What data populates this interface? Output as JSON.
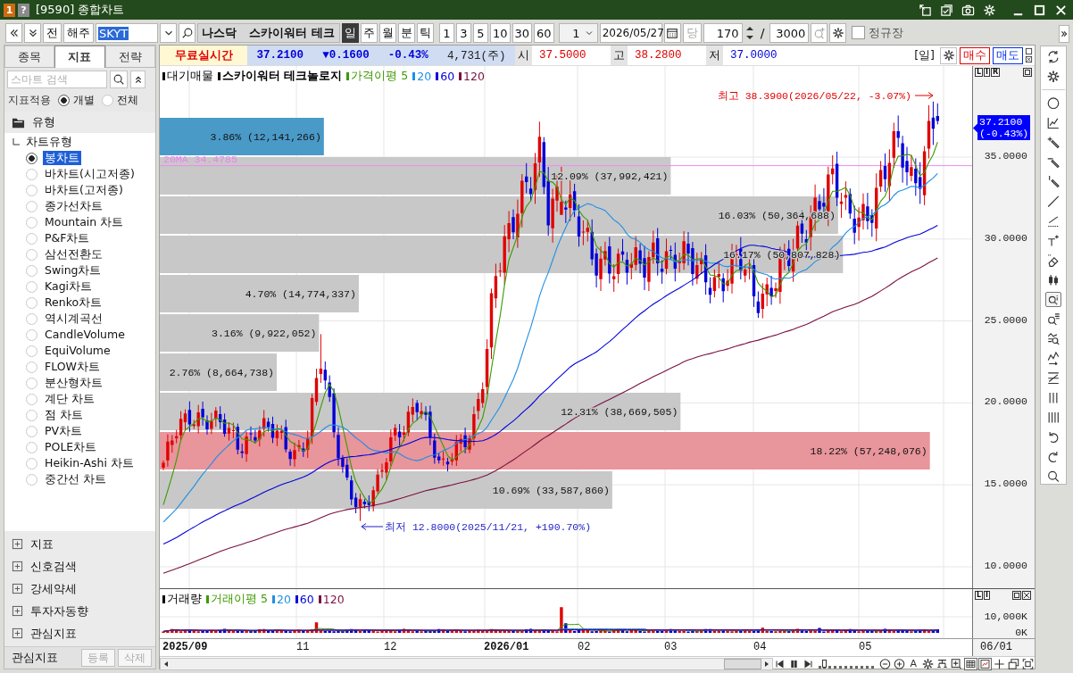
{
  "window": {
    "badge": "1",
    "help": "?",
    "title": "[9590] 종합차트"
  },
  "toolbar": {
    "buttons": [
      "전",
      "해주"
    ],
    "symbol": "SKYT",
    "market": "나스닥",
    "name": "스카이워터 테크",
    "periods": [
      {
        "label": "일",
        "selected": true
      },
      {
        "label": "주",
        "selected": false
      },
      {
        "label": "월",
        "selected": false
      },
      {
        "label": "분",
        "selected": false
      },
      {
        "label": "틱",
        "selected": false
      }
    ],
    "intervals": [
      {
        "label": "1",
        "selected": false
      },
      {
        "label": "3",
        "selected": false
      },
      {
        "label": "5",
        "selected": false
      },
      {
        "label": "10",
        "selected": false
      },
      {
        "label": "30",
        "selected": false
      },
      {
        "label": "60",
        "selected": false
      }
    ],
    "interval_value": "1",
    "date": "2026/05/27",
    "today_button": {
      "label": "당",
      "disabled": true
    },
    "count": "170",
    "separator": "/",
    "total": "3000",
    "zoom_button": {
      "disabled": true
    },
    "regular_session": {
      "label": "정규장",
      "checked": false
    }
  },
  "left_panel": {
    "tabs": [
      {
        "label": "종목",
        "selected": false
      },
      {
        "label": "지표",
        "selected": true
      },
      {
        "label": "전략",
        "selected": false
      }
    ],
    "search": {
      "placeholder": "스마트 검색"
    },
    "apply": {
      "label": "지표적용",
      "options": [
        {
          "label": "개별",
          "selected": true
        },
        {
          "label": "전체",
          "selected": false
        }
      ]
    },
    "tree": {
      "label": "유형",
      "children": [
        {
          "label": "차트유형",
          "children": [
            {
              "label": "봉차트",
              "selected": true
            },
            {
              "label": "바차트(시고저종)",
              "selected": false
            },
            {
              "label": "바차트(고저종)",
              "selected": false
            },
            {
              "label": "종가선차트",
              "selected": false
            },
            {
              "label": "Mountain 차트",
              "selected": false
            },
            {
              "label": "P&F차트",
              "selected": false
            },
            {
              "label": "삼선전환도",
              "selected": false
            },
            {
              "label": "Swing차트",
              "selected": false
            },
            {
              "label": "Kagi차트",
              "selected": false
            },
            {
              "label": "Renko차트",
              "selected": false
            },
            {
              "label": "역시계곡선",
              "selected": false
            },
            {
              "label": "CandleVolume",
              "selected": false
            },
            {
              "label": "EquiVolume",
              "selected": false
            },
            {
              "label": "FLOW차트",
              "selected": false
            },
            {
              "label": "분산형차트",
              "selected": false
            },
            {
              "label": "계단 차트",
              "selected": false
            },
            {
              "label": "점 차트",
              "selected": false
            },
            {
              "label": "PV차트",
              "selected": false
            },
            {
              "label": "POLE차트",
              "selected": false
            },
            {
              "label": "Heikin-Ashi 차트",
              "selected": false
            },
            {
              "label": "중간선 차트",
              "selected": false
            }
          ]
        }
      ]
    },
    "sections": [
      {
        "label": "지표",
        "expanded": false
      },
      {
        "label": "신호검색",
        "expanded": false
      },
      {
        "label": "강세약세",
        "expanded": false
      },
      {
        "label": "투자자동향",
        "expanded": false
      },
      {
        "label": "관심지표",
        "expanded": false
      }
    ],
    "footer": {
      "label": "관심지표",
      "buttons": [
        {
          "label": "등록",
          "disabled": true
        },
        {
          "label": "삭제",
          "disabled": true
        }
      ]
    }
  },
  "quote": {
    "feed": "무료실시간",
    "summary": [
      {
        "text": "37.2100",
        "color": "#0000d8"
      },
      {
        "text": "▼0.1600",
        "color": "#0000d8"
      },
      {
        "text": "-0.43%",
        "color": "#0000d8"
      },
      {
        "text": "4,731(주)",
        "color": "#222222"
      }
    ],
    "fields": [
      {
        "label": "시",
        "value": "37.5000",
        "color": "#e00000"
      },
      {
        "label": "고",
        "value": "38.2800",
        "color": "#e00000"
      },
      {
        "label": "저",
        "value": "37.0000",
        "color": "#0000d8"
      }
    ],
    "period": "[일]",
    "buy": "매수",
    "sell": "매도"
  },
  "chart": {
    "legend": [
      {
        "label": "대기매물",
        "kind": "indicator",
        "color": "#000000"
      },
      {
        "label": "스카이워터 테크놀로지",
        "kind": "symbol",
        "color": "#000000"
      },
      {
        "label": "가격이평 5",
        "kind": "average",
        "color": "#3c9a00"
      },
      {
        "label": "20",
        "kind": "average",
        "color": "#1e8fe6"
      },
      {
        "label": "60",
        "kind": "average",
        "color": "#0000dc"
      },
      {
        "label": "120",
        "kind": "average",
        "color": "#7a1040"
      }
    ],
    "reference": "20MA 34.4785",
    "high_note": "최고 38.3900(2026/05/22, -3.07%)",
    "low_note": "최저 12.8000(2025/11/21, +190.70%)",
    "bands": [
      {
        "label": "3.86% (12,141,266)",
        "level": 0.202,
        "color": "#4a9ac8"
      },
      {
        "label": "12.09% (37,992,421)",
        "level": 0.629,
        "color": "#c8c8c8"
      },
      {
        "label": "16.03% (50,364,688)",
        "level": 0.835,
        "color": "#c8c8c8"
      },
      {
        "label": "16.17% (50,807,828)",
        "level": 0.841,
        "color": "#c8c8c8"
      },
      {
        "label": "4.70% (14,774,337)",
        "level": 0.245,
        "color": "#c8c8c8"
      },
      {
        "label": "3.16% (9,922,052)",
        "level": 0.196,
        "color": "#c8c8c8"
      },
      {
        "label": "2.76% (8,664,738)",
        "level": 0.144,
        "color": "#c8c8c8"
      },
      {
        "label": "12.31% (38,669,505)",
        "level": 0.641,
        "color": "#c8c8c8"
      },
      {
        "label": "18.22% (57,248,076)",
        "level": 0.948,
        "color": "#e8959b"
      },
      {
        "label": "10.69% (33,587,860)",
        "level": 0.557,
        "color": "#c8c8c8"
      }
    ],
    "price_axis": {
      "scale_buttons": [
        "L",
        "I",
        "R"
      ],
      "ticks": [
        "35.0000",
        "30.0000",
        "25.0000",
        "20.0000",
        "15.0000",
        "10.0000"
      ],
      "current_price": "37.2100",
      "current_change": "(-0.43%)"
    }
  },
  "volume": {
    "legend": [
      {
        "label": "거래량",
        "color": "#000000"
      },
      {
        "label": "거래이평 5",
        "color": "#3c9a00"
      },
      {
        "label": "20",
        "color": "#1e8fe6"
      },
      {
        "label": "60",
        "color": "#0000dc"
      },
      {
        "label": "120",
        "color": "#7a1040"
      }
    ],
    "scale_buttons": [
      "L",
      "I"
    ],
    "ticks": [
      "10,000K",
      "0K"
    ]
  },
  "time_axis": {
    "labels": [
      {
        "label": "2025/09",
        "kind": "year"
      },
      {
        "label": "11",
        "kind": "month"
      },
      {
        "label": "12",
        "kind": "month"
      },
      {
        "label": "2026/01",
        "kind": "year"
      },
      {
        "label": "02",
        "kind": "month"
      },
      {
        "label": "03",
        "kind": "month"
      },
      {
        "label": "04",
        "kind": "month"
      },
      {
        "label": "05",
        "kind": "month"
      }
    ],
    "end_label": "06/01"
  },
  "drawing_tools": [
    {
      "selected": false
    },
    {
      "selected": false
    },
    {
      "selected": false
    },
    {
      "selected": false
    },
    {
      "selected": false
    },
    {
      "selected": false
    },
    {
      "selected": false
    },
    {
      "selected": false
    },
    {
      "selected": false
    },
    {
      "selected": false
    },
    {
      "selected": false
    },
    {
      "selected": false
    },
    {
      "selected": true
    },
    {
      "selected": false
    },
    {
      "selected": false
    },
    {
      "selected": false
    },
    {
      "selected": false
    },
    {
      "selected": false
    },
    {
      "selected": false
    },
    {
      "selected": false
    },
    {
      "selected": false
    },
    {
      "selected": false
    }
  ],
  "bottom_bar": {
    "zoom": {
      "level": 0.06
    },
    "tools": [
      {
        "selected": false
      },
      {
        "selected": false
      },
      {
        "label": "A",
        "selected": false
      },
      {
        "selected": false
      },
      {
        "selected": false
      },
      {
        "selected": false
      },
      {
        "selected": true
      },
      {
        "selected": true
      },
      {
        "selected": false
      },
      {
        "selected": false
      },
      {
        "selected": false
      }
    ]
  }
}
